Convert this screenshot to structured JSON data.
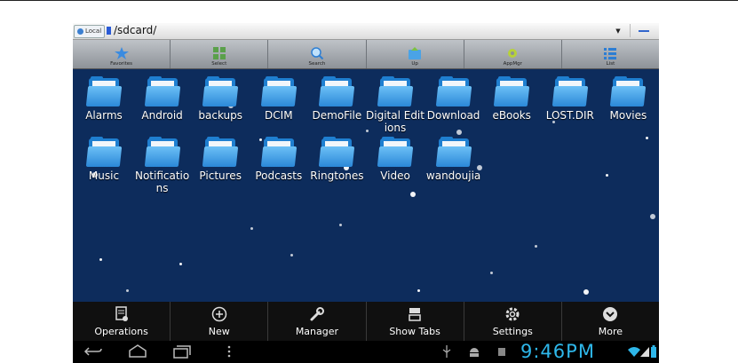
{
  "pathbar": {
    "local_label": "Local",
    "path": "/sdcard/",
    "dropdown": "▼"
  },
  "toolbar": [
    {
      "label": "Favorites",
      "icon": "star-icon"
    },
    {
      "label": "Select",
      "icon": "grid-icon"
    },
    {
      "label": "Search",
      "icon": "magnifier-icon"
    },
    {
      "label": "Up",
      "icon": "folder-up-icon"
    },
    {
      "label": "AppMgr",
      "icon": "gear-icon"
    },
    {
      "label": "List",
      "icon": "list-icon"
    }
  ],
  "folders": [
    [
      "Alarms",
      "Android",
      "backups",
      "DCIM",
      "DemoFile",
      "Digital Editions",
      "Download",
      "eBooks",
      "LOST.DIR",
      "Movies"
    ],
    [
      "Music",
      "Notifications",
      "Pictures",
      "Podcasts",
      "Ringtones",
      "Video",
      "wandoujia"
    ]
  ],
  "actionbar": [
    {
      "label": "Operations",
      "icon": "operations-icon"
    },
    {
      "label": "New",
      "icon": "plus-circle-icon"
    },
    {
      "label": "Manager",
      "icon": "wrench-icon"
    },
    {
      "label": "Show Tabs",
      "icon": "tabs-icon"
    },
    {
      "label": "Settings",
      "icon": "gear-icon"
    },
    {
      "label": "More",
      "icon": "chevron-down-circle-icon"
    }
  ],
  "status": {
    "time": "9:46PM"
  },
  "colors": {
    "background": "#0d2c5c",
    "folder": "#2b88d8",
    "clock": "#2eb7ea"
  }
}
